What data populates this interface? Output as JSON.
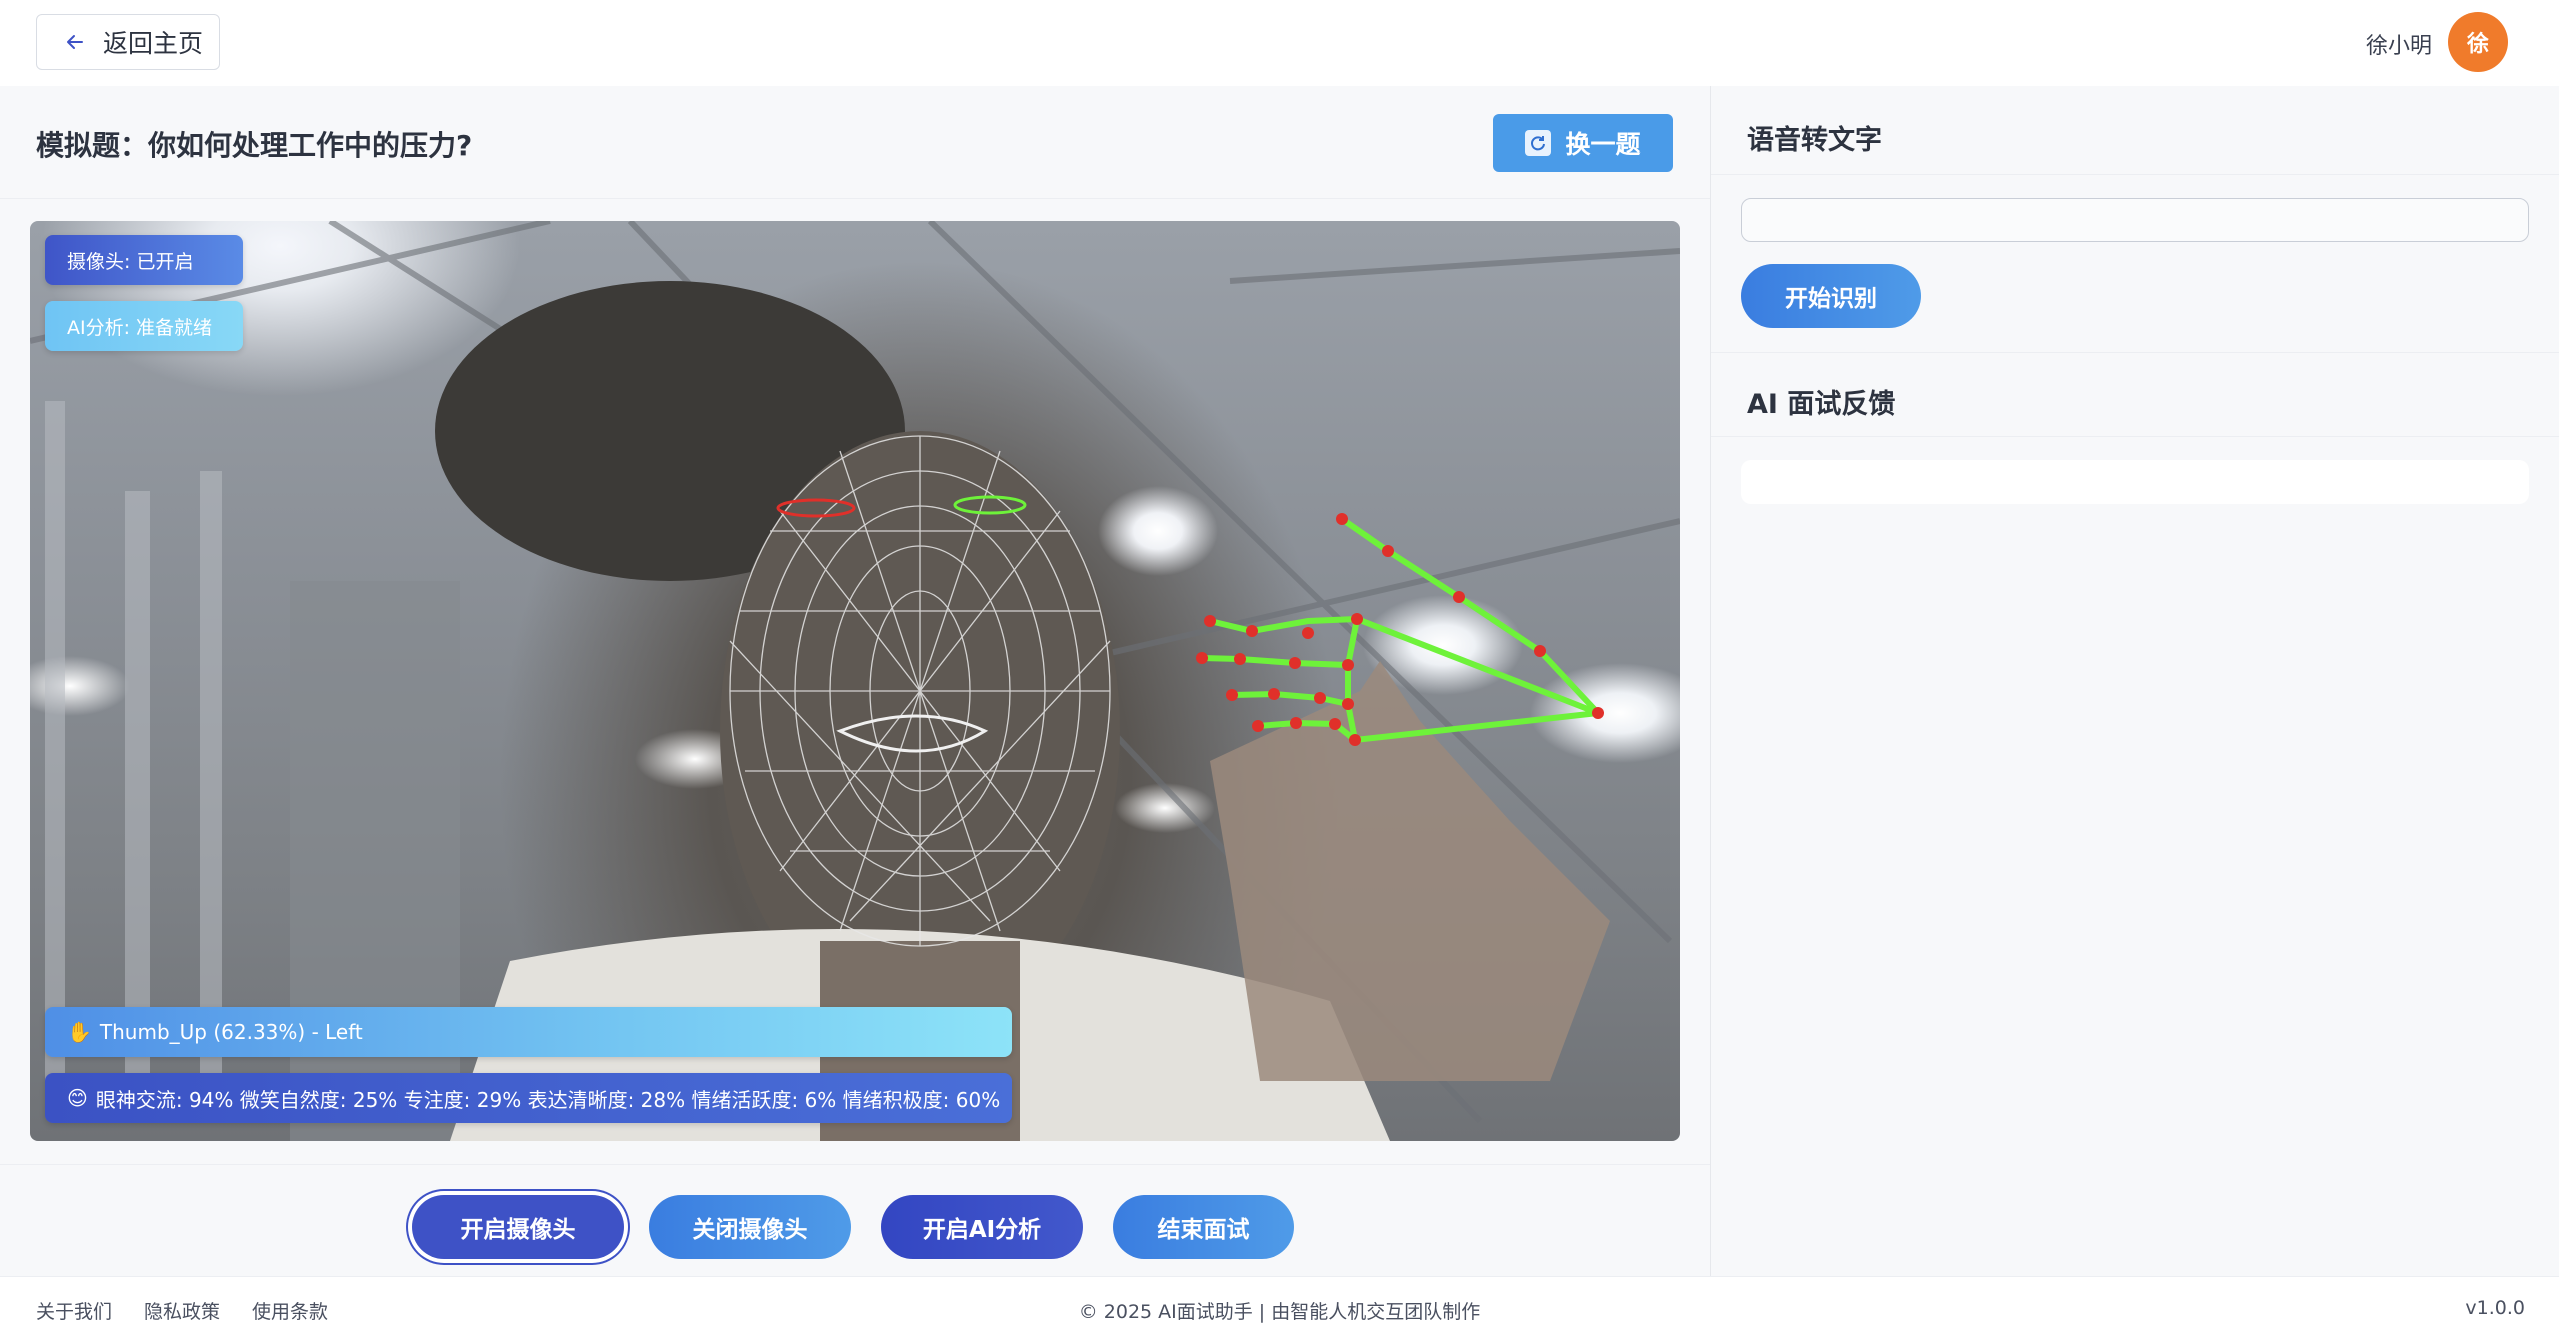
{
  "header": {
    "back_label": "返回主页",
    "user_name": "徐小明",
    "avatar_text": "徐"
  },
  "question": {
    "text": "模拟题：你如何处理工作中的压力?",
    "swap_label": "换一题"
  },
  "video": {
    "camera_status": "摄像头: 已开启",
    "ai_status": "AI分析: 准备就绪",
    "gesture_text": "Thumb_Up (62.33%) - Left",
    "metrics_text": "眼神交流: 94% 微笑自然度: 25% 专注度: 29% 表达清晰度: 28% 情绪活跃度: 6% 情绪积极度: 60%"
  },
  "controls": {
    "open_camera": "开启摄像头",
    "close_camera": "关闭摄像头",
    "start_ai": "开启AI分析",
    "end_interview": "结束面试"
  },
  "speech": {
    "title": "语音转文字",
    "input_value": "",
    "start_label": "开始识别"
  },
  "feedback": {
    "title": "AI 面试反馈",
    "content": ""
  },
  "footer": {
    "about": "关于我们",
    "privacy": "隐私政策",
    "terms": "使用条款",
    "copyright": "© 2025 AI面试助手 | 由智能人机交互团队制作",
    "version": "v1.0.0"
  },
  "colors": {
    "primary": "#3e52c6",
    "accent": "#4a9be8",
    "avatar": "#f07b2b",
    "hand_skeleton": "#6ef23a",
    "landmark": "#e0302a"
  }
}
